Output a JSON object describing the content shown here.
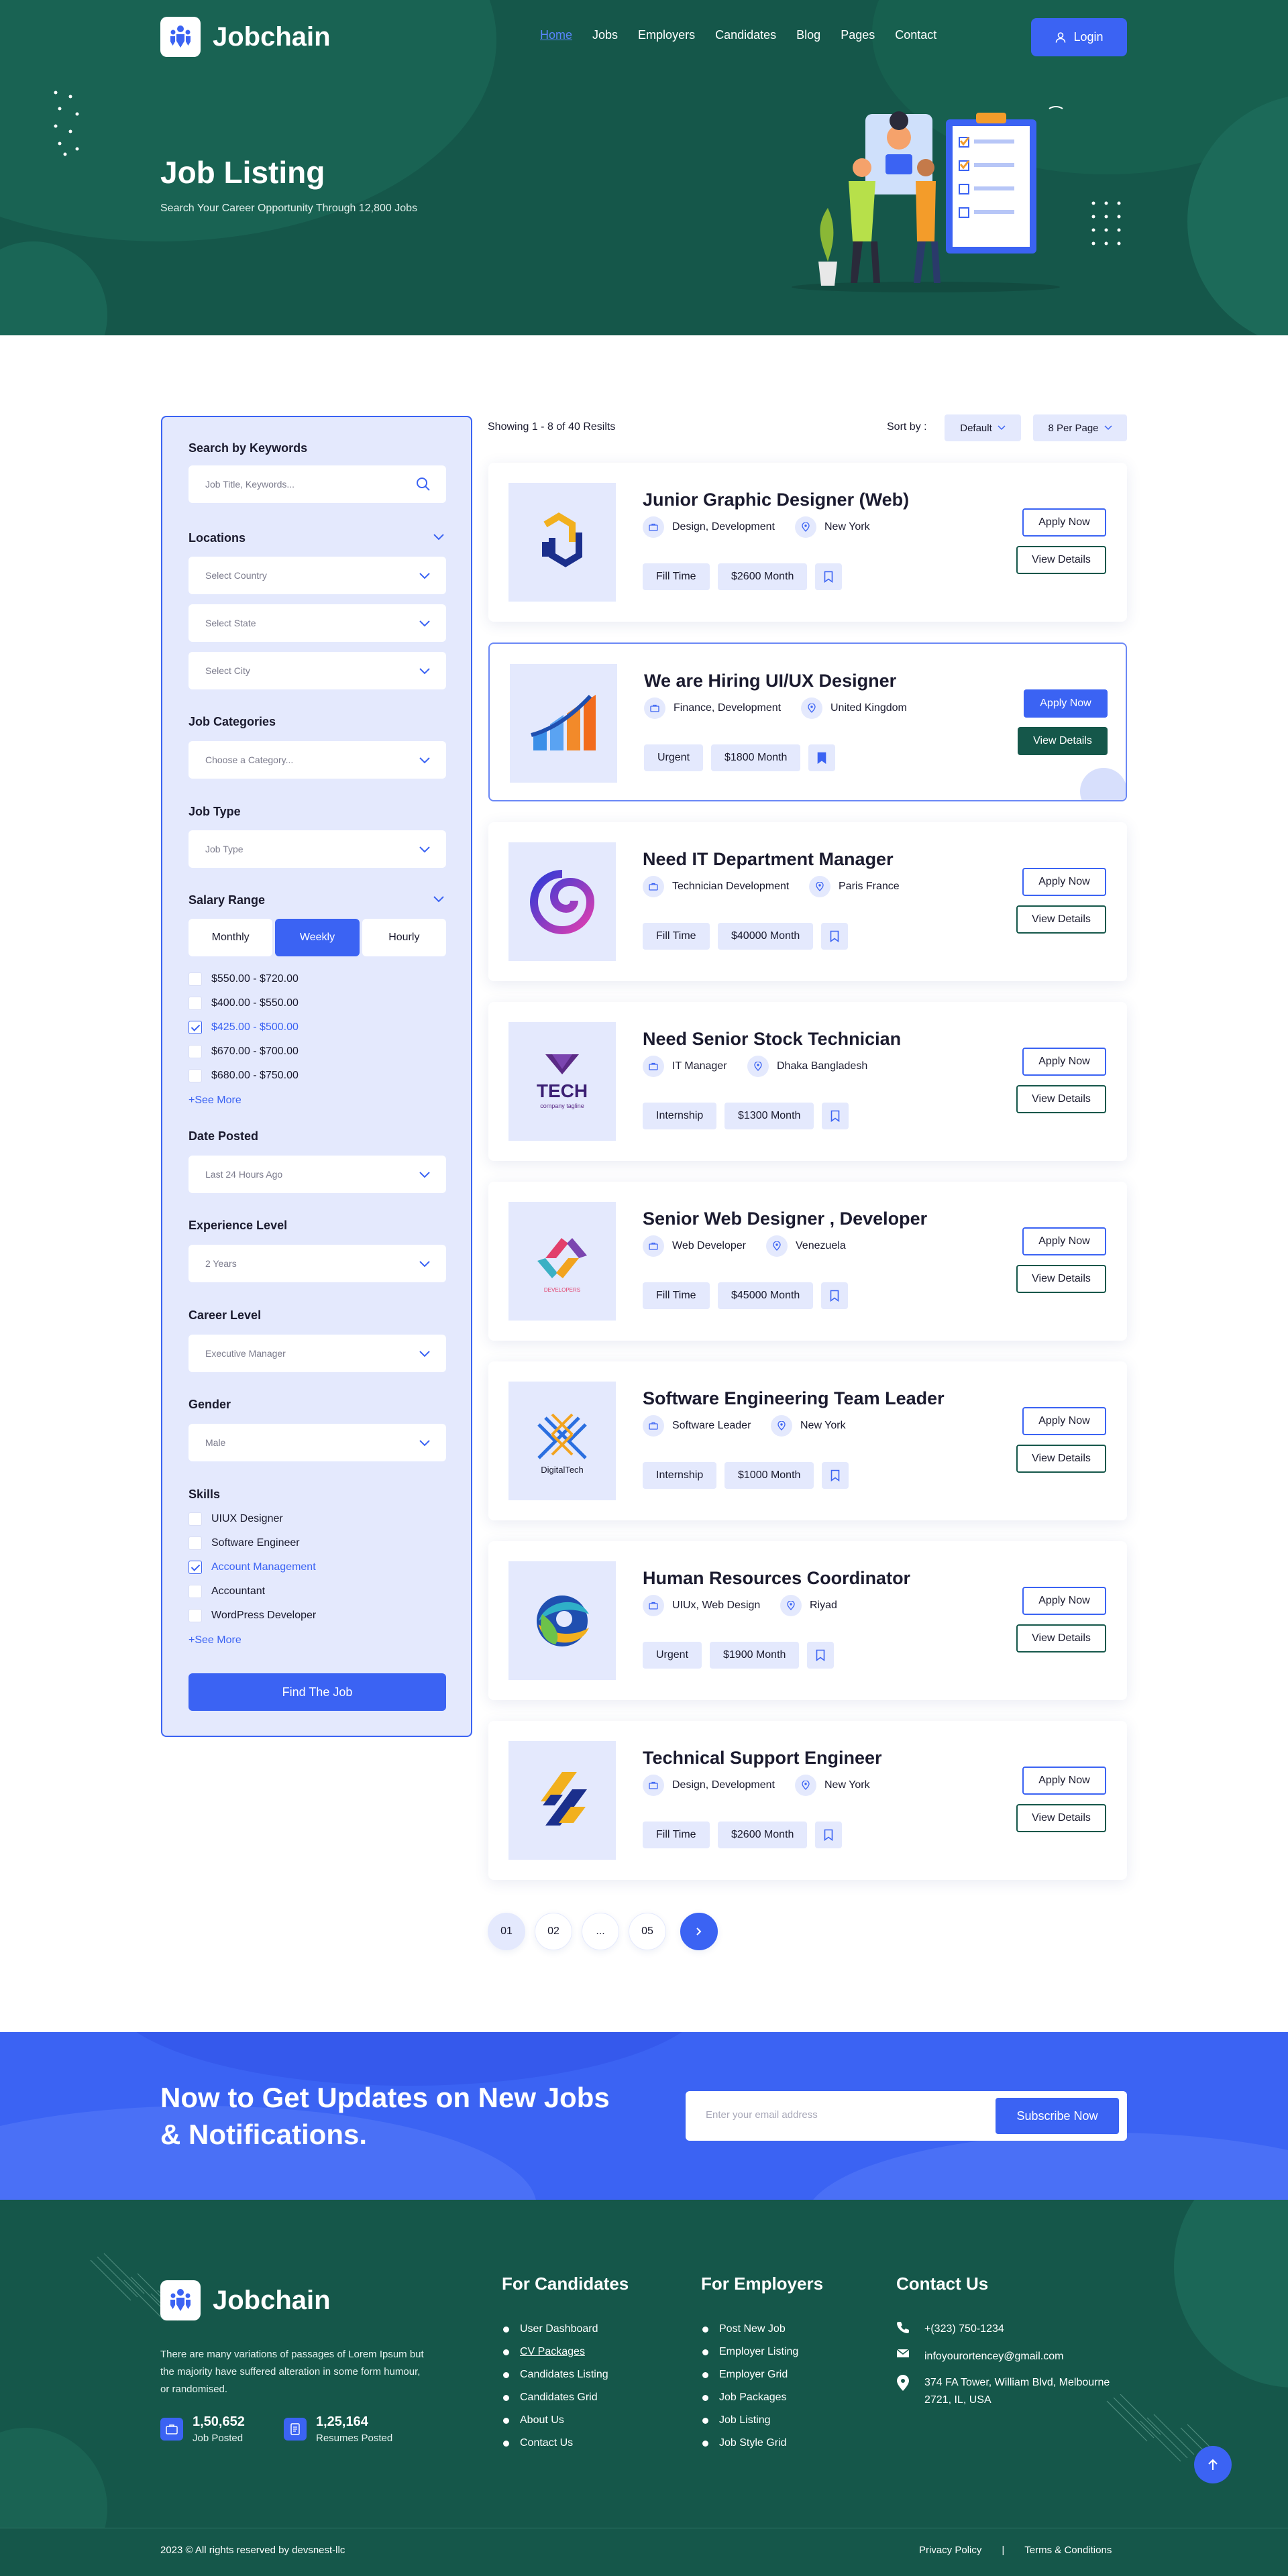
{
  "brand": {
    "name": "Jobchain"
  },
  "nav": {
    "items": [
      "Home",
      "Jobs",
      "Employers",
      "Candidates",
      "Blog",
      "Pages",
      "Contact"
    ],
    "active": "Home",
    "login": "Login"
  },
  "hero": {
    "title": "Job Listing",
    "subtitle": "Search Your Career Opportunity Through 12,800 Jobs"
  },
  "filters": {
    "keywords": {
      "heading": "Search by Keywords",
      "placeholder": "Job Title, Keywords..."
    },
    "locations": {
      "heading": "Locations",
      "country": "Select Country",
      "state": "Select State",
      "city": "Select City"
    },
    "categories": {
      "heading": "Job Categories",
      "value": "Choose a Category..."
    },
    "job_type": {
      "heading": "Job Type",
      "value": "Job Type"
    },
    "salary": {
      "heading": "Salary Range",
      "periods": [
        "Monthly",
        "Weekly",
        "Hourly"
      ],
      "selected_period": "Weekly",
      "ranges": [
        {
          "label": "$550.00 - $720.00",
          "checked": false
        },
        {
          "label": "$400.00 - $550.00",
          "checked": false
        },
        {
          "label": "$425.00 - $500.00",
          "checked": true
        },
        {
          "label": "$670.00 - $700.00",
          "checked": false
        },
        {
          "label": "$680.00 - $750.00",
          "checked": false
        }
      ],
      "more": "+See More"
    },
    "date_posted": {
      "heading": "Date Posted",
      "value": "Last 24 Hours Ago"
    },
    "experience": {
      "heading": "Experience Level",
      "value": "2 Years"
    },
    "career": {
      "heading": "Career Level",
      "value": "Executive Manager"
    },
    "gender": {
      "heading": "Gender",
      "value": "Male"
    },
    "skills": {
      "heading": "Skills",
      "items": [
        {
          "label": "UIUX Designer",
          "checked": false
        },
        {
          "label": "Software Engineer",
          "checked": false
        },
        {
          "label": "Account Management",
          "checked": true
        },
        {
          "label": "Accountant",
          "checked": false
        },
        {
          "label": "WordPress Developer",
          "checked": false
        }
      ],
      "more": "+See More"
    },
    "submit": "Find The Job"
  },
  "listing": {
    "showing": "Showing 1 - 8 of 40 Resilts",
    "sort_label": "Sort by :",
    "sort_value": "Default",
    "per_page": "8 Per Page"
  },
  "jobs": [
    {
      "title": "Junior Graphic Designer (Web)",
      "category": "Design, Development",
      "location": "New York",
      "type": "Fill Time",
      "salary": "$2600 Month",
      "logo": "hexagon-logo",
      "highlighted": false
    },
    {
      "title": "We are Hiring UI/UX Designer",
      "category": "Finance, Development",
      "location": "United Kingdom",
      "type": "Urgent",
      "salary": "$1800 Month",
      "logo": "growth-arrow-logo",
      "highlighted": true
    },
    {
      "title": "Need IT Department Manager",
      "category": "Technician Development",
      "location": "Paris France",
      "type": "Fill Time",
      "salary": "$40000 Month",
      "logo": "swirl-logo",
      "highlighted": false
    },
    {
      "title": "Need Senior Stock Technician",
      "category": "IT Manager",
      "location": "Dhaka Bangladesh",
      "type": "Internship",
      "salary": "$1300 Month",
      "logo": "tech-logo",
      "logo_text": "TECH",
      "logo_sub": "company tagline",
      "highlighted": false
    },
    {
      "title": "Senior Web Designer , Developer",
      "category": "Web Developer",
      "location": "Venezuela",
      "type": "Fill Time",
      "salary": "$45000 Month",
      "logo": "developers-logo",
      "logo_text": "DEVELOPERS",
      "highlighted": false
    },
    {
      "title": "Software Engineering Team Leader",
      "category": "Software Leader",
      "location": "New York",
      "type": "Internship",
      "salary": "$1000 Month",
      "logo": "digitaltech-logo",
      "logo_text": "DigitalTech",
      "highlighted": false
    },
    {
      "title": "Human Resources Coordinator",
      "category": "UIUx, Web Design",
      "location": "Riyad",
      "type": "Urgent",
      "salary": "$1900 Month",
      "logo": "globe-swirl-logo",
      "highlighted": false
    },
    {
      "title": "Technical Support Engineer",
      "category": "Design, Development",
      "location": "New York",
      "type": "Fill Time",
      "salary": "$2600 Month",
      "logo": "stripes-logo",
      "highlighted": false
    }
  ],
  "job_actions": {
    "apply": "Apply Now",
    "view": "View Details"
  },
  "pagination": {
    "pages": [
      "01",
      "02",
      "...",
      "05"
    ],
    "current": "01"
  },
  "newsletter": {
    "title": "Now to Get Updates on New Jobs & Notifications.",
    "placeholder": "Enter your email address",
    "button": "Subscribe Now"
  },
  "footer": {
    "brand": "Jobchain",
    "description": "There are many variations of passages of Lorem Ipsum but the majority have suffered alteration in some form humour, or randomised.",
    "stats": [
      {
        "value": "1,50,652",
        "label": "Job Posted"
      },
      {
        "value": "1,25,164",
        "label": "Resumes Posted"
      }
    ],
    "candidates": {
      "heading": "For Candidates",
      "links": [
        "User Dashboard",
        "CV Packages",
        "Candidates Listing",
        "Candidates Grid",
        "About Us",
        "Contact Us"
      ]
    },
    "employers": {
      "heading": "For Employers",
      "links": [
        "Post New Job",
        "Employer Listing",
        "Employer Grid",
        "Job Packages",
        "Job Listing",
        "Job Style Grid"
      ]
    },
    "contact": {
      "heading": "Contact Us",
      "phone": "+(323) 750-1234",
      "email": "infoyourortencey@gmail.com",
      "address_line1": "374 FA Tower, William Blvd, Melbourne",
      "address_line2": "2721, IL, USA"
    },
    "copyright": "2023 © All rights reserved by devsnest-llc",
    "legal": [
      "Privacy Policy",
      "|",
      "Terms & Conditions"
    ]
  },
  "colors": {
    "primary": "#3b63f3",
    "dark_green": "#15574a",
    "soft_blue": "#e4e9fd"
  }
}
